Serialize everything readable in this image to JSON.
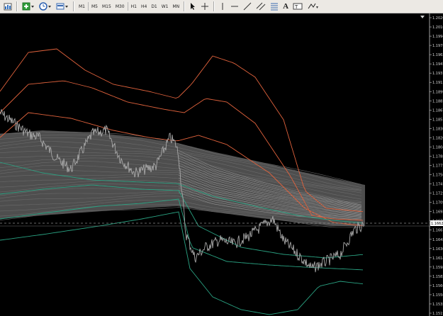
{
  "toolbar": {
    "timeframes": [
      "M1",
      "M5",
      "M15",
      "M30",
      "H1",
      "H4",
      "D1",
      "W1",
      "MN"
    ]
  },
  "chart": {
    "background": "#000000",
    "price_labels": [
      "1.20262",
      "1.20103",
      "1.19945",
      "1.19787",
      "1.19628",
      "1.19470",
      "1.19311",
      "1.19153",
      "1.18994",
      "1.18836",
      "1.18677",
      "1.18519",
      "1.18361",
      "1.18202",
      "1.18044",
      "1.17885",
      "1.17727",
      "1.17568",
      "1.17410",
      "1.17252",
      "1.17093",
      "1.16935",
      "1.16776",
      "1.16618",
      "1.16459",
      "1.16301",
      "1.16142",
      "1.15984",
      "1.15826",
      "1.15667",
      "1.15509",
      "1.15350",
      "1.15192"
    ],
    "current_price": "1.16629",
    "colors": {
      "price_line": "#a8a8a8",
      "ribbon": "#8e8e8e",
      "upper_band": "#e0623c",
      "lower_band": "#2aa383",
      "current_price_box": "#ffffff"
    }
  }
}
